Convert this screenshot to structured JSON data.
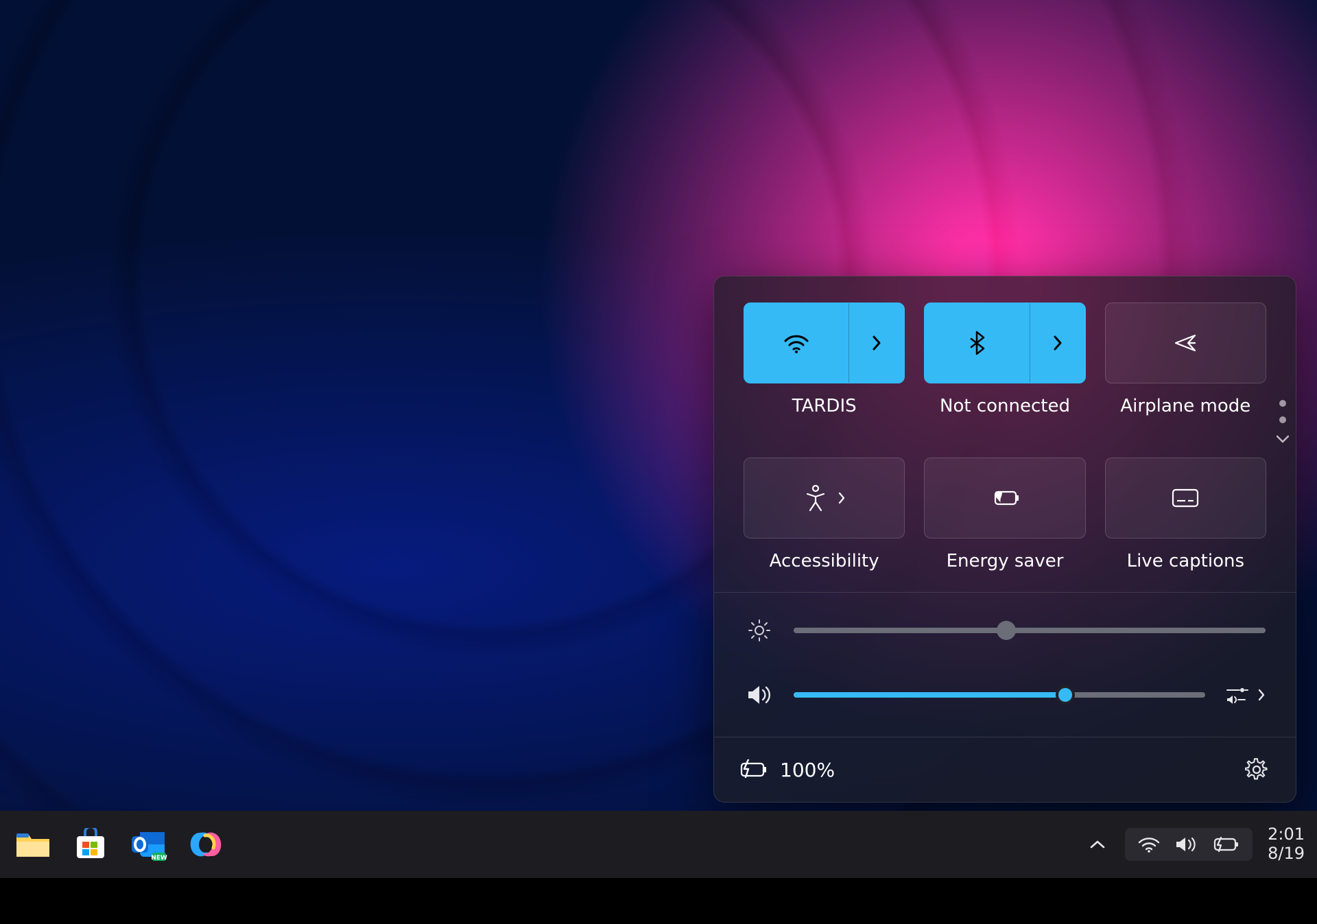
{
  "panel": {
    "tiles": [
      {
        "key": "wifi",
        "label": "TARDIS",
        "active": true,
        "split": true
      },
      {
        "key": "bluetooth",
        "label": "Not connected",
        "active": true,
        "split": true
      },
      {
        "key": "airplane",
        "label": "Airplane mode",
        "active": false,
        "split": false
      },
      {
        "key": "accessibility",
        "label": "Accessibility",
        "active": false,
        "split": false,
        "inline_expand": true
      },
      {
        "key": "energy",
        "label": "Energy saver",
        "active": false,
        "split": false
      },
      {
        "key": "captions",
        "label": "Live captions",
        "active": false,
        "split": false
      }
    ],
    "brightness_pct": 45,
    "volume_pct": 66,
    "battery_pct_label": "100%"
  },
  "taskbar": {
    "time": "2:01",
    "date": "8/19"
  },
  "colors": {
    "accent": "#35baf6"
  }
}
